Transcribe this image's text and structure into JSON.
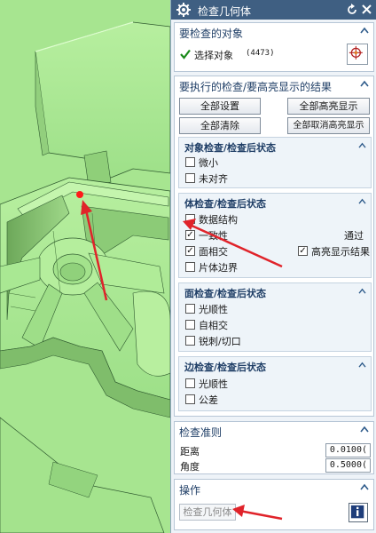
{
  "window": {
    "title": "检查几何体"
  },
  "select_objects": {
    "title": "要检查的对象",
    "label": "选择对象",
    "count": "(4473)"
  },
  "checks": {
    "title": "要执行的检查/要高亮显示的结果",
    "buttons": [
      "全部设置",
      "全部高亮显示",
      "全部清除",
      "全部取消高亮显示"
    ],
    "object_checks": {
      "title": "对象检查/检查后状态",
      "items": [
        {
          "label": "微小",
          "checked": false
        },
        {
          "label": "未对齐",
          "checked": false
        }
      ]
    },
    "body_checks": {
      "title": "体检查/检查后状态",
      "items": [
        {
          "label": "数据结构",
          "checked": false
        },
        {
          "label": "一致性",
          "checked": true
        },
        {
          "label": "面相交",
          "checked": true
        },
        {
          "label": "片体边界",
          "checked": false
        }
      ],
      "result": "通过",
      "highlight": {
        "label": "高亮显示结果",
        "checked": true
      }
    },
    "face_checks": {
      "title": "面检查/检查后状态",
      "items": [
        {
          "label": "光顺性",
          "checked": false
        },
        {
          "label": "自相交",
          "checked": false
        },
        {
          "label": "锐刺/切口",
          "checked": false
        }
      ]
    },
    "edge_checks": {
      "title": "边检查/检查后状态",
      "items": [
        {
          "label": "光顺性",
          "checked": false
        },
        {
          "label": "公差",
          "checked": false
        }
      ]
    }
  },
  "criteria": {
    "title": "检查准则",
    "distance": {
      "label": "距离",
      "value": "0.0100("
    },
    "angle": {
      "label": "角度",
      "value": "0.5000("
    }
  },
  "operations": {
    "title": "操作",
    "button": "检查几何体"
  },
  "colors": {
    "model": "#a5e58f",
    "titlebar": "#3f5f82",
    "section_title": "#1f3e66",
    "arrow": "#e0232a"
  },
  "icons": [
    "gear-icon",
    "reset-icon",
    "close-icon",
    "collapse-icon",
    "checkmark-icon",
    "crosshair-icon",
    "info-icon"
  ]
}
